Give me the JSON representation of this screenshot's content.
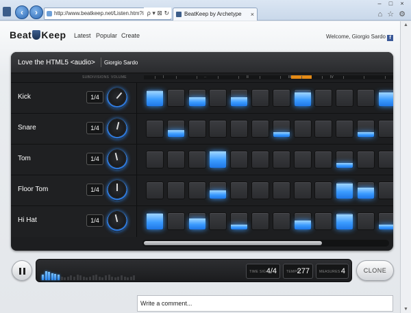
{
  "browser": {
    "url": "http://www.beatkeep.net/Listen.htm?id=1451",
    "addr_tools": "ρ ▾ ⊠ ↻ ×",
    "tab_title": "BeatKeep by Archetype",
    "tab_close": "×",
    "win_min": "–",
    "win_max": "□",
    "win_close": "×",
    "tool_home": "⌂",
    "tool_fav": "☆",
    "tool_gear": "⚙",
    "icons": {
      "back": "back-arrow-icon",
      "forward": "forward-arrow-icon"
    }
  },
  "site": {
    "logo_left": "Beat",
    "logo_right": "Keep",
    "nav": [
      "Latest",
      "Popular",
      "Create"
    ],
    "welcome": "Welcome, Giorgio Sardo",
    "fb": "f"
  },
  "song": {
    "title": "Love the HTML5 <audio>",
    "author": "Giorgio Sardo"
  },
  "columns": {
    "subdivisions": "SUBDIVISIONS",
    "volume": "VOLUME"
  },
  "ruler_marks": [
    "I",
    "··",
    "II",
    "III",
    "IV"
  ],
  "tracks": [
    {
      "name": "Kick",
      "subdivision": "1/4",
      "volume": 0.65,
      "pads": [
        0.9,
        0,
        0.55,
        0,
        0.55,
        0,
        0,
        0.85,
        0,
        0,
        0,
        0.85
      ]
    },
    {
      "name": "Snare",
      "subdivision": "1/4",
      "volume": 0.55,
      "pads": [
        0,
        0.4,
        0,
        0,
        0,
        0,
        0.3,
        0,
        0,
        0,
        0.3,
        0
      ]
    },
    {
      "name": "Tom",
      "subdivision": "1/4",
      "volume": 0.45,
      "pads": [
        0,
        0,
        0,
        1.0,
        0,
        0,
        0,
        0,
        0,
        0.3,
        0,
        0
      ]
    },
    {
      "name": "Floor Tom",
      "subdivision": "1/4",
      "volume": 0.5,
      "pads": [
        0,
        0,
        0,
        0.5,
        0,
        0,
        0,
        0,
        0,
        0.9,
        0.65,
        0
      ]
    },
    {
      "name": "Hi Hat",
      "subdivision": "1/4",
      "volume": 0.45,
      "pads": [
        0.95,
        0,
        0.65,
        0,
        0.3,
        0,
        0,
        0.55,
        0,
        0.9,
        0,
        0.3
      ]
    }
  ],
  "transport": {
    "meter_levels": [
      0.3,
      0.5,
      0.45,
      0.4,
      0.35,
      0.3,
      0.2,
      0.15,
      0.2,
      0.25,
      0.2,
      0.3,
      0.25,
      0.2,
      0.15,
      0.2,
      0.25,
      0.3,
      0.2,
      0.15,
      0.25,
      0.3,
      0.2,
      0.15,
      0.2,
      0.25,
      0.2,
      0.15,
      0.2,
      0.25
    ],
    "meter_active_count": 6,
    "time_sig_label": "TIME SIG",
    "time_sig": "4/4",
    "tempo_label": "TEMPO",
    "tempo": "277",
    "measures_label": "MEASURES",
    "measures": "4",
    "clone_label": "CLONE"
  },
  "comment": {
    "placeholder": "Write a comment..."
  }
}
